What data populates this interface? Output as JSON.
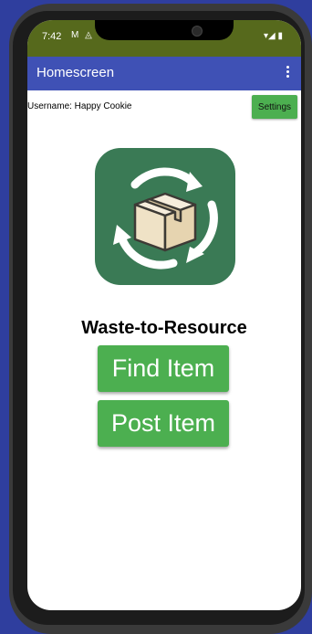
{
  "status_bar": {
    "time": "7:42",
    "left_icons": "M ◬",
    "right_icons": "▾◢ ▮"
  },
  "appbar": {
    "title": "Homescreen",
    "menu_icon": "more-vert-icon"
  },
  "user": {
    "username_text": "Username: Happy Cookie"
  },
  "settings": {
    "label": "Settings"
  },
  "logo": {
    "icon": "recycle-box-icon",
    "bg_color": "#3a7a55",
    "box_color": "#f1e6cf"
  },
  "main": {
    "app_name": "Waste-to-Resource",
    "find_label": "Find Item",
    "post_label": "Post Item"
  },
  "colors": {
    "appbar": "#3f51b5",
    "button": "#4caf50",
    "status_bar": "#56691c"
  }
}
